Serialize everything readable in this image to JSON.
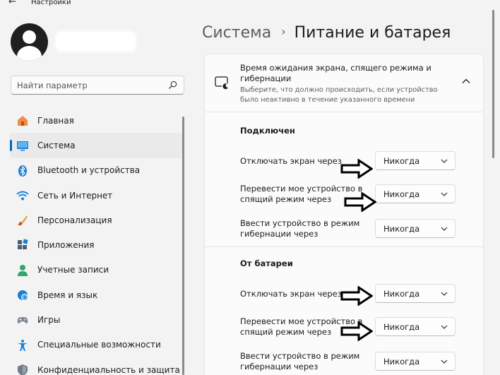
{
  "window": {
    "app_title": "Настройки",
    "back_icon": "arrow-left-icon"
  },
  "search": {
    "placeholder": "Найти параметр",
    "icon": "search-icon"
  },
  "nav": {
    "items": [
      {
        "label": "Главная",
        "icon": "home-icon",
        "active": false
      },
      {
        "label": "Система",
        "icon": "display-icon",
        "active": true
      },
      {
        "label": "Bluetooth и устройства",
        "icon": "bluetooth-icon",
        "active": false
      },
      {
        "label": "Сеть и Интернет",
        "icon": "wifi-icon",
        "active": false
      },
      {
        "label": "Персонализация",
        "icon": "brush-icon",
        "active": false
      },
      {
        "label": "Приложения",
        "icon": "apps-icon",
        "active": false
      },
      {
        "label": "Учетные записи",
        "icon": "person-icon",
        "active": false
      },
      {
        "label": "Время и язык",
        "icon": "globe-clock-icon",
        "active": false
      },
      {
        "label": "Игры",
        "icon": "gamepad-icon",
        "active": false
      },
      {
        "label": "Специальные возможности",
        "icon": "accessibility-icon",
        "active": false
      },
      {
        "label": "Конфиденциальность и защита",
        "icon": "shield-icon",
        "active": false
      }
    ]
  },
  "breadcrumb": {
    "parent": "Система",
    "separator": "›",
    "current": "Питание и батарея"
  },
  "panel": {
    "header_title": "Время ожидания экрана, спящего режима и гибернации",
    "header_desc": "Выберите, что должно происходить, если устройство было неактивно в течение указанного времени",
    "expanded": true,
    "sections": [
      {
        "title": "Подключен",
        "rows": [
          {
            "label": "Отключать экран через",
            "value": "Никогда"
          },
          {
            "label": "Перевести мое устройство в спящий режим через",
            "value": "Никогда"
          },
          {
            "label": "Ввести устройство в режим гибернации через",
            "value": "Никогда"
          }
        ]
      },
      {
        "title": "От батареи",
        "rows": [
          {
            "label": "Отключать экран через",
            "value": "Никогда"
          },
          {
            "label": "Перевести мое устройство в спящий режим через",
            "value": "Никогда"
          },
          {
            "label": "Ввести устройство в режим гибернации через",
            "value": "Никогда"
          }
        ]
      }
    ]
  },
  "annotations": {
    "arrow_icon": "right-arrow-annotation-icon"
  },
  "colors": {
    "accent": "#0067c0",
    "background": "#f3f3f3",
    "card": "#fbfbfb"
  }
}
